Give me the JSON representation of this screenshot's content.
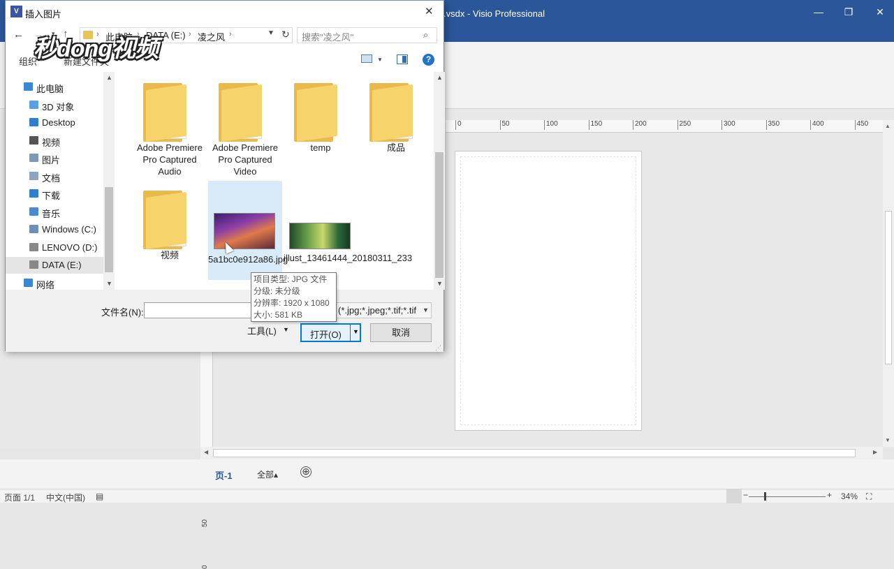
{
  "visio": {
    "title": "图.vsdx - Visio Professional",
    "ruler_ticks": [
      "0",
      "50",
      "100",
      "150",
      "200",
      "250",
      "300",
      "350",
      "400",
      "450"
    ],
    "vruler_ticks": [
      "50",
      "0"
    ],
    "page_tab": "页-1",
    "all_tab": "全部▴",
    "add_page": "⊕",
    "status": {
      "page": "页面 1/1",
      "language": "中文(中国)",
      "zoom": "34%"
    }
  },
  "dialog": {
    "title": "插入图片",
    "icon_text": "V",
    "breadcrumbs": [
      "此电脑",
      "DATA (E:)",
      "凌之风"
    ],
    "search_placeholder": "搜索\"凌之风\"",
    "toolbar": {
      "organize": "组织",
      "new_folder": "新建文件夹"
    },
    "nav_items": [
      {
        "label": "此电脑",
        "icon_color": "#3a87d4",
        "indent": 1
      },
      {
        "label": "3D 对象",
        "icon_color": "#5aa0e0",
        "indent": 2
      },
      {
        "label": "Desktop",
        "icon_color": "#2f7fd0",
        "indent": 2
      },
      {
        "label": "视频",
        "icon_color": "#555555",
        "indent": 2
      },
      {
        "label": "图片",
        "icon_color": "#7a9ab8",
        "indent": 2
      },
      {
        "label": "文档",
        "icon_color": "#8aa4c2",
        "indent": 2
      },
      {
        "label": "下载",
        "icon_color": "#2f7fd0",
        "indent": 2
      },
      {
        "label": "音乐",
        "icon_color": "#4a8ad0",
        "indent": 2
      },
      {
        "label": "Windows (C:)",
        "icon_color": "#6b8fb8",
        "indent": 2
      },
      {
        "label": "LENOVO (D:)",
        "icon_color": "#888888",
        "indent": 2
      },
      {
        "label": "DATA (E:)",
        "icon_color": "#888888",
        "indent": 2,
        "selected": true
      },
      {
        "label": "网络",
        "icon_color": "#3a87d4",
        "indent": 1
      }
    ],
    "files": [
      {
        "name": "Adobe Premiere Pro Captured Audio",
        "kind": "folder"
      },
      {
        "name": "Adobe Premiere Pro Captured Video",
        "kind": "folder"
      },
      {
        "name": "temp",
        "kind": "folder-empty"
      },
      {
        "name": "成品",
        "kind": "folder-art"
      },
      {
        "name": "视频",
        "kind": "folder-art"
      },
      {
        "name": "5a1bc0e912a86.jpg",
        "kind": "image-purple",
        "selected": true
      },
      {
        "name": "illust_13461444_20180311_233",
        "kind": "image-green"
      }
    ],
    "filename_label": "文件名(N):",
    "filename_value": "",
    "filter_value": "(*.jpg;*.jpeg;*.tif;*.tif",
    "tools_label": "工具(L)",
    "open_label": "打开(O)",
    "cancel_label": "取消",
    "tooltip": [
      "项目类型: JPG 文件",
      "分级: 未分级",
      "分辨率: 1920 x 1080",
      "大小: 581 KB"
    ]
  },
  "watermark": "秒dong视频"
}
